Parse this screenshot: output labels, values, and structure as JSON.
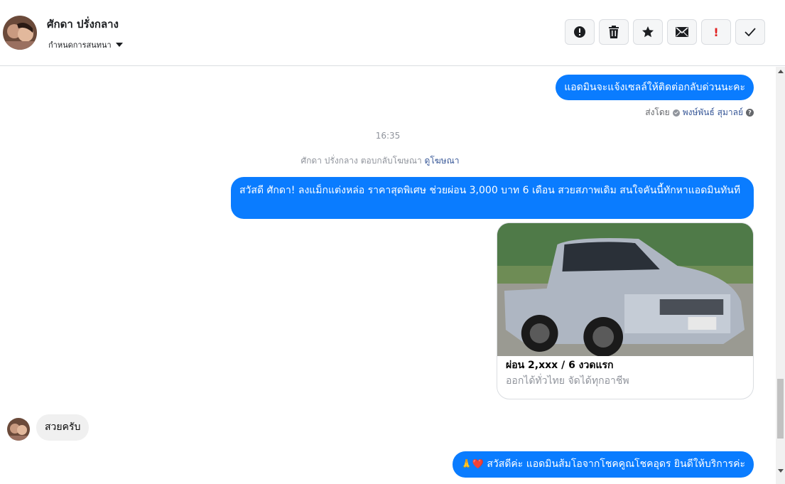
{
  "header": {
    "contact_name": "ศักดา ปรั่งกลาง",
    "assign_label": "กำหนดการสนทนา",
    "actions": [
      {
        "name": "spam-icon",
        "color": "#1c1e21"
      },
      {
        "name": "trash-icon",
        "color": "#1c1e21"
      },
      {
        "name": "star-icon",
        "color": "#1c1e21"
      },
      {
        "name": "envelope-icon",
        "color": "#1c1e21"
      },
      {
        "name": "exclamation-icon",
        "color": "#e02020"
      },
      {
        "name": "check-icon",
        "color": "#1c1e21"
      }
    ],
    "urgent_glyph": "!"
  },
  "messages": {
    "out1": "แอดมินจะแจ้งเซลล์ให้ติดต่อกลับด่วนนะคะ",
    "sent_by_label": "ส่งโดย",
    "sent_by_name": "พงษ์พันธ์ สุมาลย์",
    "help_glyph": "?",
    "timestamp": "16:35",
    "reply_note": "ศักดา ปรั่งกลาง ตอบกลับโฆษณา",
    "reply_link": "ดูโฆษณา",
    "out2": "สวัสดี ศักดา! ลงแม็กแต่งหล่อ ราคาสุดพิเศษ ช่วยผ่อน 3,000 บาท 6 เดือน สวยสภาพเดิม สนใจคันนี้ทักหาแอดมินทันที",
    "card_title": "ผ่อน 2,xxx / 6 งวดแรก",
    "card_subtitle": "ออกได้ทั่วไทย จัดได้ทุกอาชีพ",
    "in1": "สวยครับ",
    "out3_emoji": "🙏❤️",
    "out3": "สวัสดีค่ะ แอดมินส้มโอจากโชคคูณโชคอุดร ยินดีให้บริการค่ะ"
  },
  "colors": {
    "outgoing_bubble": "#0a7cff",
    "incoming_bubble": "#f0f0f0",
    "link": "#385898"
  }
}
